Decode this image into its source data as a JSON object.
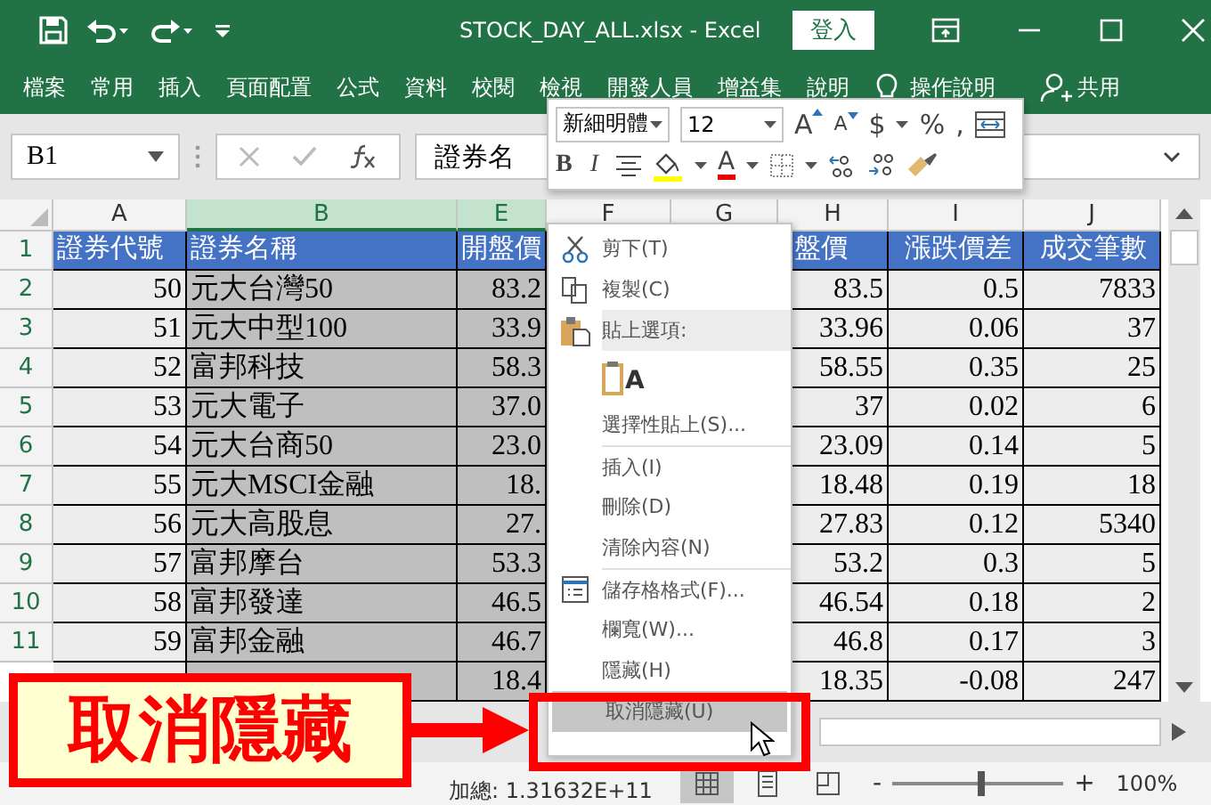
{
  "title_bar": {
    "title": "STOCK_DAY_ALL.xlsx  -  Excel",
    "sign_in": "登入"
  },
  "ribbon_tabs": [
    "檔案",
    "常用",
    "插入",
    "頁面配置",
    "公式",
    "資料",
    "校閱",
    "檢視",
    "開發人員",
    "增益集",
    "說明"
  ],
  "tell_me": "操作說明",
  "share": "共用",
  "formula_bar": {
    "name_box": "B1",
    "value": "證券名"
  },
  "mini_toolbar": {
    "font": "新細明體",
    "size": "12",
    "grow": "A",
    "shrink": "A",
    "currency": "$",
    "percent": "%",
    "comma": ",",
    "bold": "B",
    "italic": "I",
    "font_color": "A"
  },
  "columns": [
    {
      "label": "A",
      "selected": false
    },
    {
      "label": "B",
      "selected": true
    },
    {
      "label": "E",
      "selected": true
    },
    {
      "label": "F",
      "selected": false
    },
    {
      "label": "G",
      "selected": false
    },
    {
      "label": "H",
      "selected": false
    },
    {
      "label": "I",
      "selected": false
    },
    {
      "label": "J",
      "selected": false
    }
  ],
  "rows": [
    {
      "num": "1",
      "kind": "header",
      "cells": [
        "證券代號",
        "證券名稱",
        "開盤價",
        null,
        null,
        "盤價",
        "漲跌價差",
        "成交筆數"
      ]
    },
    {
      "num": "2",
      "kind": "data",
      "cells": [
        "50",
        "元大台灣50",
        "83.2",
        null,
        null,
        "83.5",
        "0.5",
        "7833"
      ]
    },
    {
      "num": "3",
      "kind": "data",
      "cells": [
        "51",
        "元大中型100",
        "33.9",
        null,
        null,
        "33.96",
        "0.06",
        "37"
      ]
    },
    {
      "num": "4",
      "kind": "data",
      "cells": [
        "52",
        "富邦科技",
        "58.3",
        null,
        null,
        "58.55",
        "0.35",
        "25"
      ]
    },
    {
      "num": "5",
      "kind": "data",
      "cells": [
        "53",
        "元大電子",
        "37.0",
        null,
        null,
        "37",
        "0.02",
        "6"
      ]
    },
    {
      "num": "6",
      "kind": "data",
      "cells": [
        "54",
        "元大台商50",
        "23.0",
        null,
        null,
        "23.09",
        "0.14",
        "5"
      ]
    },
    {
      "num": "7",
      "kind": "data",
      "cells": [
        "55",
        "元大MSCI金融",
        "18.",
        null,
        null,
        "18.48",
        "0.19",
        "18"
      ]
    },
    {
      "num": "8",
      "kind": "data",
      "cells": [
        "56",
        "元大高股息",
        "27.",
        null,
        null,
        "27.83",
        "0.12",
        "5340"
      ]
    },
    {
      "num": "9",
      "kind": "data",
      "cells": [
        "57",
        "富邦摩台",
        "53.3",
        null,
        null,
        "53.2",
        "0.3",
        "5"
      ]
    },
    {
      "num": "10",
      "kind": "data",
      "cells": [
        "58",
        "富邦發達",
        "46.5",
        null,
        null,
        "46.54",
        "0.18",
        "2"
      ]
    },
    {
      "num": "11",
      "kind": "data",
      "cells": [
        "59",
        "富邦金融",
        "46.7",
        null,
        null,
        "46.8",
        "0.17",
        "3"
      ]
    },
    {
      "kind": "data",
      "cells": [
        null,
        null,
        "18.4",
        null,
        null,
        "18.35",
        "-0.08",
        "247"
      ]
    }
  ],
  "context_menu": [
    {
      "kind": "cut",
      "label": "剪下(T)",
      "selected": false,
      "divider_before": false
    },
    {
      "kind": "copy",
      "label": "複製(C)",
      "selected": false,
      "divider_before": false
    },
    {
      "kind": "paste_header",
      "label": "貼上選項:",
      "selected": false,
      "divider_before": false
    },
    {
      "kind": "paste_option",
      "glyph": "A",
      "selected": false,
      "divider_before": false
    },
    {
      "kind": "plain",
      "label": "選擇性貼上(S)...",
      "selected": false,
      "divider_before": false
    },
    {
      "kind": "plain",
      "label": "插入(I)",
      "selected": false,
      "divider_before": true
    },
    {
      "kind": "plain",
      "label": "刪除(D)",
      "selected": false,
      "divider_before": false
    },
    {
      "kind": "plain",
      "label": "清除內容(N)",
      "selected": false,
      "divider_before": false
    },
    {
      "kind": "format",
      "label": "儲存格格式(F)...",
      "selected": false,
      "divider_before": true
    },
    {
      "kind": "plain",
      "label": "欄寬(W)...",
      "selected": false,
      "divider_before": false
    },
    {
      "kind": "plain",
      "label": "隱藏(H)",
      "selected": false,
      "divider_before": false
    },
    {
      "kind": "plain",
      "label": "取消隱藏(U)",
      "selected": true,
      "divider_before": false
    }
  ],
  "callout": {
    "text": "取消隱藏"
  },
  "status_bar": {
    "sum": "加總: 1.31632E+11",
    "zoom_out": "-",
    "zoom_in": "+",
    "level": 0.5,
    "zoom": "100%"
  }
}
